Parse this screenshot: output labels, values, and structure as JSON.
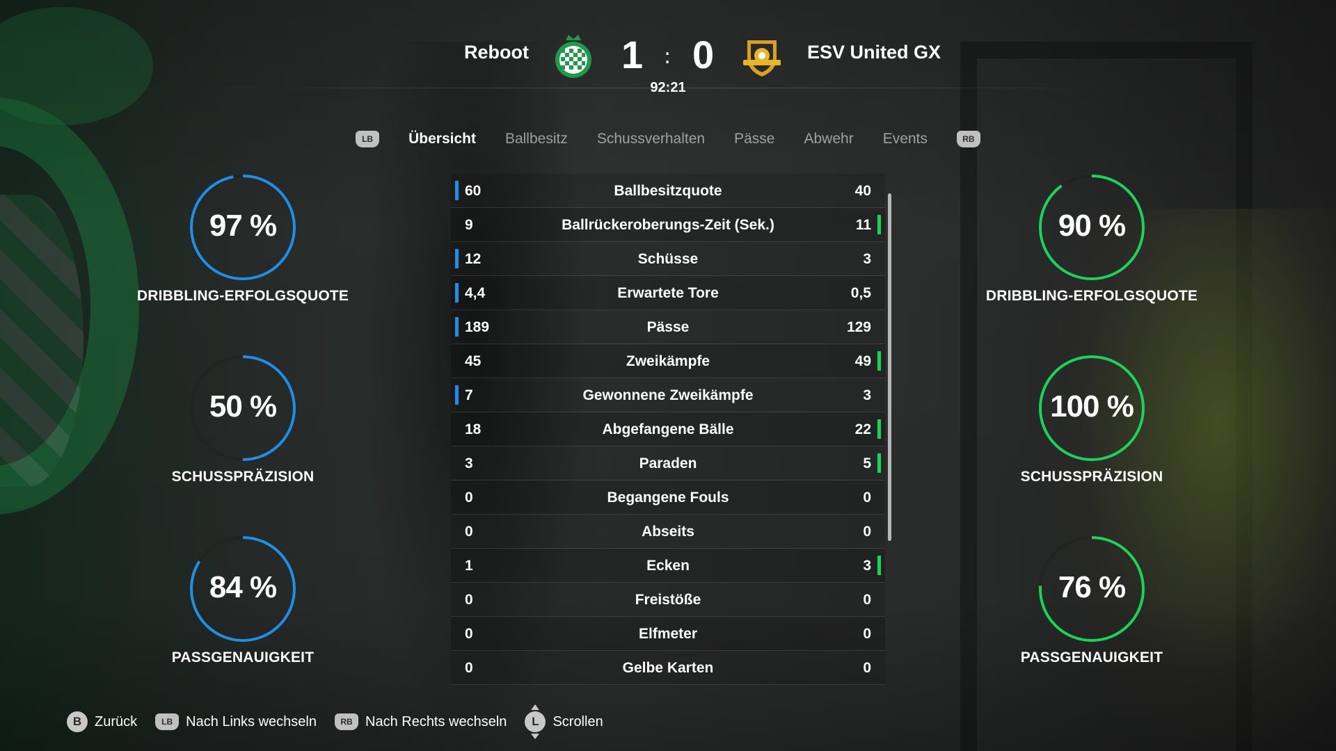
{
  "colors": {
    "home_accent": "#1e8fe6",
    "away_accent": "#19d35a"
  },
  "header": {
    "home_team": "Reboot",
    "away_team": "ESV United GX",
    "home_score": "1",
    "away_score": "0",
    "separator": ":",
    "clock": "92:21",
    "home_crest_icon": "green-checkered-crest-icon",
    "away_crest_icon": "gold-shield-crest-icon"
  },
  "tabs": {
    "left_bumper": "LB",
    "right_bumper": "RB",
    "items": [
      {
        "label": "Übersicht",
        "active": true
      },
      {
        "label": "Ballbesitz",
        "active": false
      },
      {
        "label": "Schussverhalten",
        "active": false
      },
      {
        "label": "Pässe",
        "active": false
      },
      {
        "label": "Abwehr",
        "active": false
      },
      {
        "label": "Events",
        "active": false
      }
    ]
  },
  "home_gauges": [
    {
      "value": "97 %",
      "fraction": 0.97,
      "label": "DRIBBLING-ERFOLGSQUOTE"
    },
    {
      "value": "50 %",
      "fraction": 0.5,
      "label": "SCHUSSPRÄZISION"
    },
    {
      "value": "84 %",
      "fraction": 0.84,
      "label": "PASSGENAUIGKEIT"
    }
  ],
  "away_gauges": [
    {
      "value": "90 %",
      "fraction": 0.9,
      "label": "DRIBBLING-ERFOLGSQUOTE"
    },
    {
      "value": "100 %",
      "fraction": 1.0,
      "label": "SCHUSSPRÄZISION"
    },
    {
      "value": "76 %",
      "fraction": 0.76,
      "label": "PASSGENAUIGKEIT"
    }
  ],
  "stats": [
    {
      "home": "60",
      "label": "Ballbesitzquote",
      "away": "40",
      "lead": "home"
    },
    {
      "home": "9",
      "label": "Ballrückeroberungs-Zeit (Sek.)",
      "away": "11",
      "lead": "away"
    },
    {
      "home": "12",
      "label": "Schüsse",
      "away": "3",
      "lead": "home"
    },
    {
      "home": "4,4",
      "label": "Erwartete Tore",
      "away": "0,5",
      "lead": "home"
    },
    {
      "home": "189",
      "label": "Pässe",
      "away": "129",
      "lead": "home"
    },
    {
      "home": "45",
      "label": "Zweikämpfe",
      "away": "49",
      "lead": "away"
    },
    {
      "home": "7",
      "label": "Gewonnene Zweikämpfe",
      "away": "3",
      "lead": "home"
    },
    {
      "home": "18",
      "label": "Abgefangene Bälle",
      "away": "22",
      "lead": "away"
    },
    {
      "home": "3",
      "label": "Paraden",
      "away": "5",
      "lead": "away"
    },
    {
      "home": "0",
      "label": "Begangene Fouls",
      "away": "0",
      "lead": "none"
    },
    {
      "home": "0",
      "label": "Abseits",
      "away": "0",
      "lead": "none"
    },
    {
      "home": "1",
      "label": "Ecken",
      "away": "3",
      "lead": "away"
    },
    {
      "home": "0",
      "label": "Freistöße",
      "away": "0",
      "lead": "none"
    },
    {
      "home": "0",
      "label": "Elfmeter",
      "away": "0",
      "lead": "none"
    },
    {
      "home": "0",
      "label": "Gelbe Karten",
      "away": "0",
      "lead": "none"
    }
  ],
  "footer": {
    "back_button": "B",
    "back_label": "Zurück",
    "left_button": "LB",
    "left_label": "Nach Links wechseln",
    "right_button": "RB",
    "right_label": "Nach Rechts wechseln",
    "scroll_button": "L",
    "scroll_label": "Scrollen"
  }
}
